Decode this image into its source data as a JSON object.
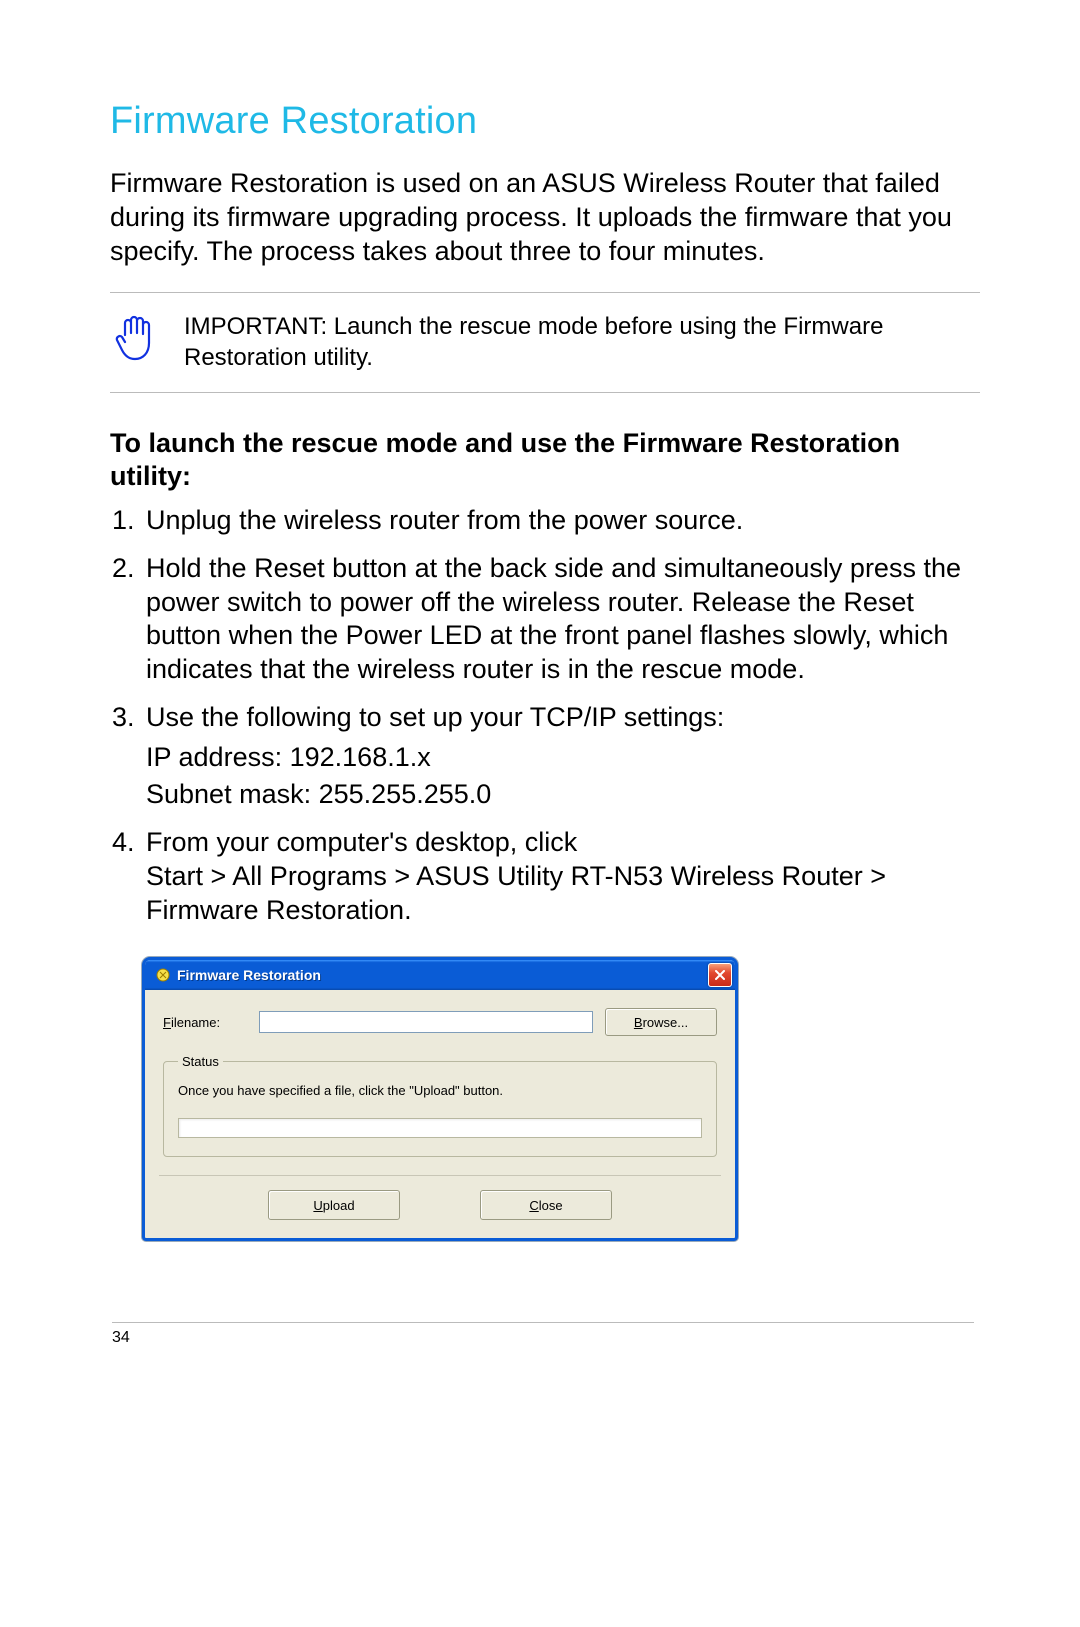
{
  "heading": "Firmware Restoration",
  "intro": "Firmware Restoration is used on an ASUS Wireless Router that failed during its firmware upgrading process. It uploads the firmware that you specify. The process takes about three to four minutes.",
  "callout": "IMPORTANT: Launch the rescue mode before using the Firmware Restoration utility.",
  "subheading": "To launch the rescue mode and use the Firmware Restoration utility:",
  "steps": {
    "s1": "Unplug the wireless router from the power source.",
    "s2": "Hold the Reset button at the back side and simultaneously press the power switch to power off the wireless router. Release the Reset button when the Power LED at the front panel flashes slowly, which indicates that the wireless router is in the rescue mode.",
    "s3_line1": "Use the following to set up your TCP/IP settings:",
    "s3_ip_label": "IP address",
    "s3_ip_value": "192.168.1.x",
    "s3_mask_label": "Subnet mask",
    "s3_mask_value": "255.255.255.0",
    "s4_line1": "From your computer's desktop, click",
    "s4_line2": "Start > All Programs > ASUS Utility RT-N53 Wireless Router > Firmware Restoration."
  },
  "dialog": {
    "title": "Firmware Restoration",
    "filename_label_rest": "ilename:",
    "filename_value": "",
    "browse_rest": "rowse...",
    "status_legend": "Status",
    "status_text": "Once you have specified a file, click the \"Upload\" button.",
    "upload_rest": "pload",
    "close_rest": "lose"
  },
  "page_number": "34"
}
